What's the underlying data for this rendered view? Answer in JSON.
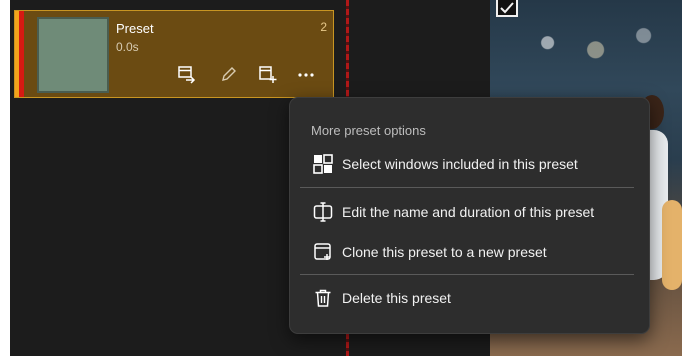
{
  "preset_card": {
    "name": "Preset",
    "duration": "0.0s",
    "number": "2",
    "actions": [
      {
        "icon": "select-windows-icon"
      },
      {
        "icon": "edit-pencil-icon"
      },
      {
        "icon": "clone-preset-icon"
      },
      {
        "icon": "more-options-icon",
        "label": "..."
      }
    ]
  },
  "preview": {
    "checkbox_checked": true
  },
  "context_menu": {
    "header": "More preset options",
    "items": [
      {
        "icon": "select-windows-icon",
        "label": "Select windows included in this preset"
      },
      {
        "icon": "edit-name-duration-icon",
        "label": "Edit the name and duration of this preset"
      },
      {
        "icon": "clone-preset-icon",
        "label": "Clone this preset to a new preset"
      },
      {
        "icon": "trash-icon",
        "label": "Delete this preset"
      }
    ]
  },
  "colors": {
    "workspace": "#1c1c1c",
    "card_background": "#6b4b12",
    "card_accent_yellow": "#f3a31b",
    "card_accent_red": "#d61a12",
    "menu_background": "#2d2d2d"
  }
}
